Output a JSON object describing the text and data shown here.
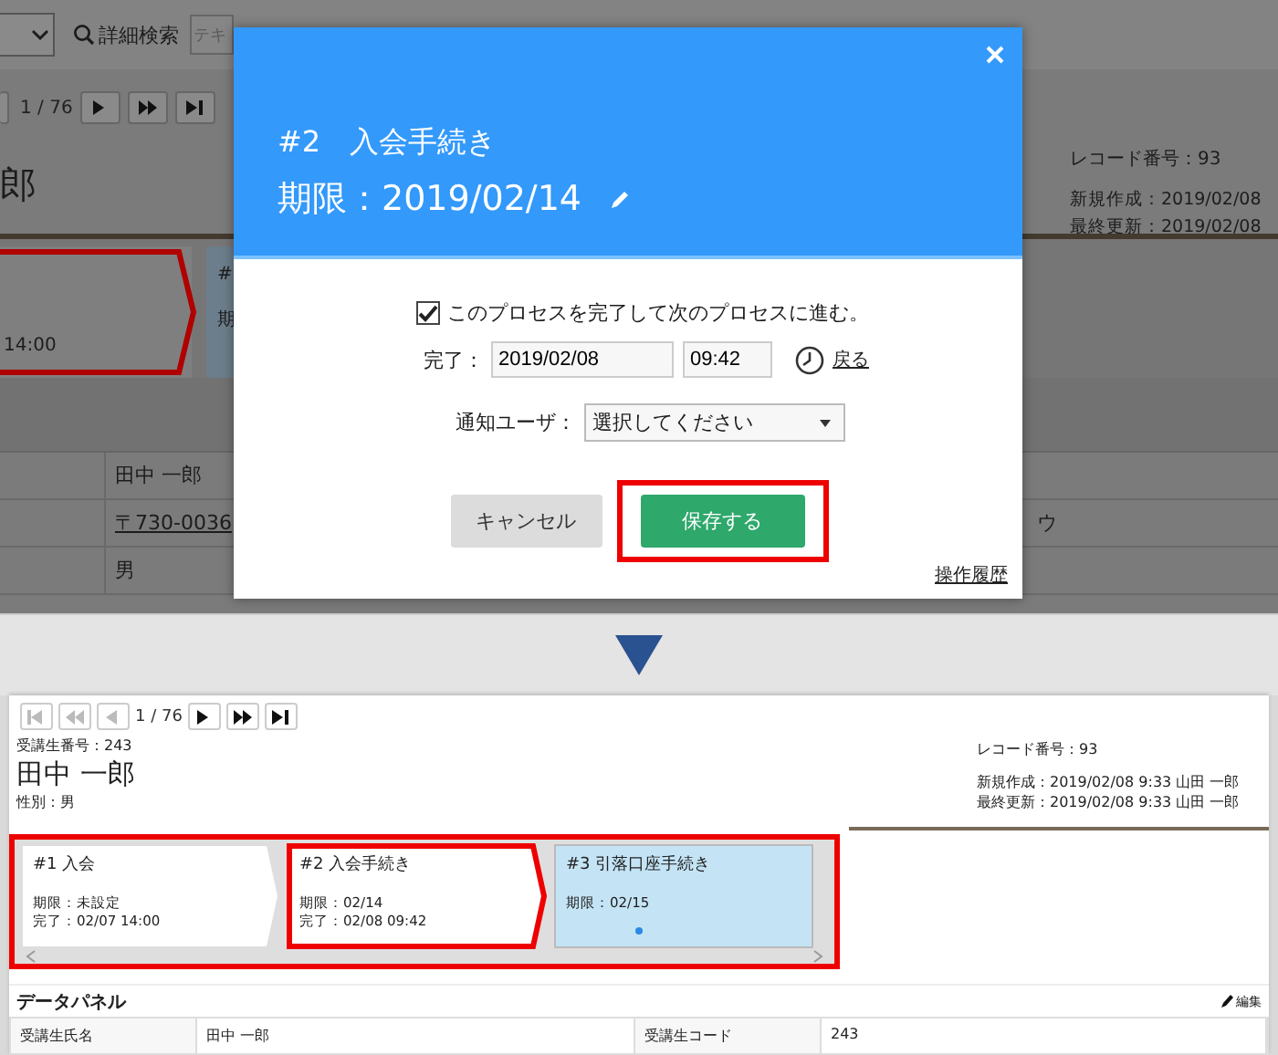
{
  "before_screen": {
    "toolbar": {
      "search_label": "詳細検索",
      "search_placeholder": "テキ"
    },
    "pager": {
      "position": "1 / 76",
      "buttons": [
        {
          "kind": "next"
        },
        {
          "kind": "fast_forward"
        },
        {
          "kind": "last"
        }
      ]
    },
    "record_name": "郎",
    "record_info": [
      "レコード番号：93",
      "新規作成：2019/02/08",
      "最終更新：2019/02/08"
    ],
    "process_cards": [
      {
        "lines": [
          "14:00"
        ],
        "highlighted": true,
        "current": false
      },
      {
        "lines": [
          "#",
          "期"
        ],
        "highlighted": false,
        "current": true
      }
    ],
    "table_rows": [
      {
        "value": "田中 一郎",
        "link": false,
        "column_3": ""
      },
      {
        "value": "〒730-0036",
        "link": true,
        "column_3": "ウ"
      },
      {
        "value": "男",
        "link": false,
        "column_3": ""
      }
    ]
  },
  "dialog": {
    "title": "#2　入会手続き",
    "deadline": "期限：2019/02/14",
    "checkbox": {
      "label": "このプロセスを完了して次のプロセスに進む。",
      "checked": true
    },
    "completion": {
      "label": "完了：",
      "date": "2019/02/08",
      "time": "09:42",
      "back_link": "戻る"
    },
    "notify": {
      "label": "通知ユーザ：",
      "value": "選択してください"
    },
    "buttons": [
      {
        "kind": "cancel",
        "label": "キャンセル",
        "highlighted": false
      },
      {
        "kind": "save",
        "label": "保存する",
        "highlighted": true
      }
    ],
    "history_link": "操作履歴"
  },
  "after_screen": {
    "pager": {
      "position": "1 / 76",
      "buttons": [
        {
          "kind": "first",
          "disabled": true
        },
        {
          "kind": "rewind",
          "disabled": true
        },
        {
          "kind": "prev",
          "disabled": true
        },
        {
          "kind": "next",
          "disabled": false
        },
        {
          "kind": "fast_forward",
          "disabled": false
        },
        {
          "kind": "last",
          "disabled": false
        }
      ]
    },
    "student_number": "受講生番号：243",
    "name": "田中 一郎",
    "gender": "性別：男",
    "record_info": [
      "レコード番号：93",
      "新規作成：2019/02/08 9:33 山田 一郎",
      "最終更新：2019/02/08 9:33 山田 一郎"
    ],
    "process_highlighted": true,
    "process_cards": [
      {
        "title": "#1 入会",
        "lines": [
          "期限：未設定",
          "完了：02/07 14:00"
        ],
        "highlighted": false,
        "current": false
      },
      {
        "title": "#2 入会手続き",
        "lines": [
          "期限：02/14",
          "完了：02/08 09:42"
        ],
        "highlighted": true,
        "current": false
      },
      {
        "title": "#3 引落口座手続き",
        "lines": [
          "期限：02/15"
        ],
        "highlighted": false,
        "current": true
      }
    ],
    "data_panel": {
      "title": "データパネル",
      "edit_label": "編集",
      "rows": [
        {
          "label": "受講生氏名",
          "value": "田中 一郎"
        },
        {
          "label": "受講生コード",
          "value": "243"
        }
      ]
    }
  }
}
